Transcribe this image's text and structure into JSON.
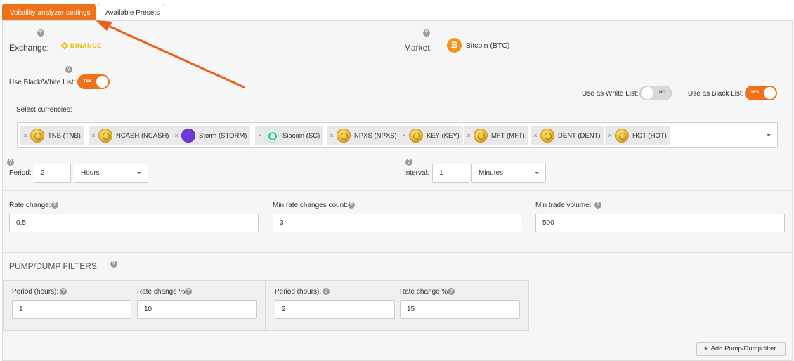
{
  "tabs": [
    {
      "label": "Volatility analyzer settings",
      "active": true
    },
    {
      "label": "Available Presets",
      "active": false
    }
  ],
  "help_glyph": "?",
  "exchange": {
    "label": "Exchange:",
    "logo_text": "BINANCE",
    "logo_color": "#f0b90b"
  },
  "market": {
    "label": "Market:",
    "value": "Bitcoin (BTC)",
    "icon_glyph": "₿",
    "icon_color": "#f7931a"
  },
  "bw_list": {
    "label": "Use Black/White List:",
    "toggle_text": "YES",
    "state": "on"
  },
  "white_list": {
    "label": "Use as White List:",
    "toggle_text": "NO",
    "state": "off"
  },
  "black_list": {
    "label": "Use as Black List:",
    "toggle_text": "YES",
    "state": "on"
  },
  "currencies": {
    "label": "Select currencies:",
    "remove_glyph": "×",
    "items": [
      {
        "name": "TNB (TNB)",
        "icon": "coin-icon"
      },
      {
        "name": "NCASH (NCASH)",
        "icon": "coin-icon"
      },
      {
        "name": "Storm (STORM)",
        "icon": "storm-icon"
      },
      {
        "name": "Siacoin (SC)",
        "icon": "siacoin-icon"
      },
      {
        "name": "NPXS (NPXS)",
        "icon": "coin-icon"
      },
      {
        "name": "KEY (KEY)",
        "icon": "coin-icon"
      },
      {
        "name": "MFT (MFT)",
        "icon": "coin-icon"
      },
      {
        "name": "DENT (DENT)",
        "icon": "coin-icon"
      },
      {
        "name": "HOT (HOT)",
        "icon": "coin-icon"
      }
    ]
  },
  "period": {
    "label": "Period:",
    "value": "2",
    "unit": "Hours"
  },
  "interval": {
    "label": "Interval:",
    "value": "1",
    "unit": "Minutes"
  },
  "rate_change": {
    "label": "Rate change:",
    "value": "0.5"
  },
  "min_rate_changes": {
    "label": "Min rate changes count:",
    "value": "3"
  },
  "min_trade_volume": {
    "label": "Min trade volume:",
    "value": "500"
  },
  "pump_dump": {
    "title": "PUMP/DUMP FILTERS:",
    "filters": [
      {
        "period_label": "Period (hours):",
        "period_value": "1",
        "rate_label": "Rate change %:",
        "rate_value": "10"
      },
      {
        "period_label": "Period (hours):",
        "period_value": "2",
        "rate_label": "Rate change %:",
        "rate_value": "15"
      }
    ],
    "add_button": "Add Pump/Dump filter",
    "add_glyph": "+"
  },
  "accent_color": "#ee7219"
}
